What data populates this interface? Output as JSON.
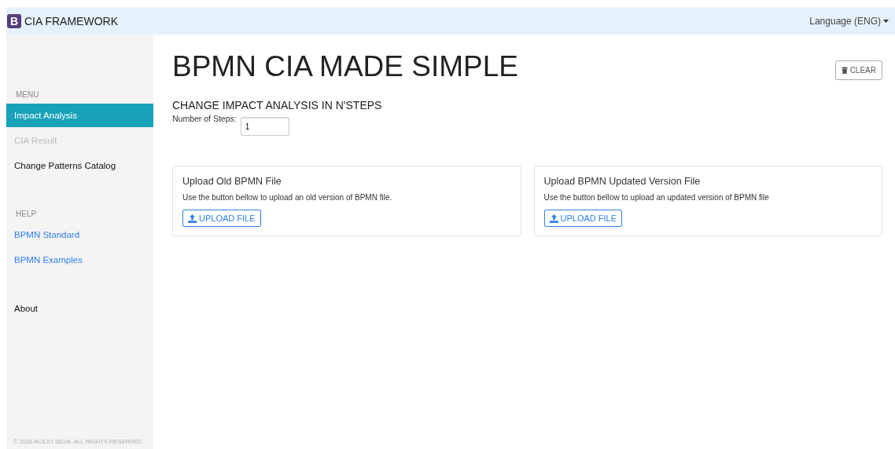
{
  "navbar": {
    "logo_letter": "B",
    "brand": "CIA FRAMEWORK",
    "language": "Language (ENG)"
  },
  "sidebar": {
    "sections": [
      {
        "heading": "MENU",
        "items": [
          {
            "label": "Impact Analysis",
            "kind": "nav",
            "selected": true,
            "disabled": false
          },
          {
            "label": "CIA Result",
            "kind": "nav",
            "selected": false,
            "disabled": true
          },
          {
            "label": "Change Patterns Catalog",
            "kind": "nav",
            "selected": false,
            "disabled": false
          }
        ]
      },
      {
        "heading": "HELP",
        "items": [
          {
            "label": "BPMN Standard",
            "kind": "link",
            "selected": false,
            "disabled": false
          },
          {
            "label": "BPMN Examples",
            "kind": "link",
            "selected": false,
            "disabled": false
          }
        ]
      },
      {
        "items": [
          {
            "label": "About",
            "kind": "nav",
            "selected": false,
            "disabled": false
          }
        ]
      }
    ],
    "footer": "© 2020 ACILIO SILVA. ALL RIGHTS RESERVED."
  },
  "main": {
    "title": "BPMN CIA MADE SIMPLE",
    "clear_button": "CLEAR",
    "subtitle": "CHANGE IMPACT ANALYSIS IN N'STEPS",
    "steps_label": "Number of Steps:",
    "steps_value": "1",
    "cards": [
      {
        "title": "Upload Old BPMN File",
        "text": "Use the button bellow to upload an old version of BPMN file.",
        "button": "UPLOAD FILE"
      },
      {
        "title": "Upload BPMN Updated Version File",
        "text": "Use the button bellow to upload an updated version of BPMN file",
        "button": "UPLOAD FILE"
      }
    ]
  }
}
